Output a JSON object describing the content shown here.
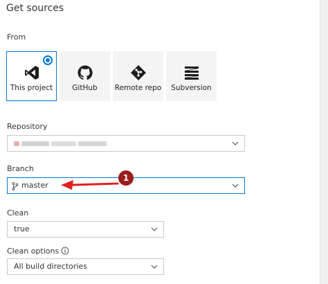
{
  "header": {
    "title": "Get sources"
  },
  "from": {
    "label": "From",
    "options": [
      {
        "label": "This project",
        "icon": "visual-studio-icon",
        "selected": true
      },
      {
        "label": "GitHub",
        "icon": "github-icon",
        "selected": false
      },
      {
        "label": "Remote repo",
        "icon": "git-icon",
        "selected": false
      },
      {
        "label": "Subversion",
        "icon": "subversion-icon",
        "selected": false
      }
    ]
  },
  "repository": {
    "label": "Repository"
  },
  "branch": {
    "label": "Branch",
    "value": "master"
  },
  "clean": {
    "label": "Clean",
    "value": "true"
  },
  "clean_options": {
    "label": "Clean options",
    "value": "All build directories"
  },
  "annotation": {
    "number": "1"
  },
  "colors": {
    "accent": "#0078d4",
    "annotation": "#9b1d1d",
    "arrow": "#e0201c"
  }
}
